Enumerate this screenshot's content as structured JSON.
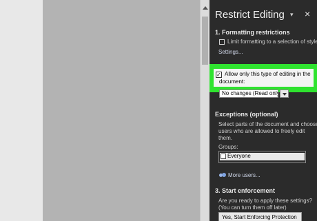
{
  "pane": {
    "title": "Restrict Editing",
    "chevron": "▾",
    "close": "×"
  },
  "formatting": {
    "heading": "1. Formatting restrictions",
    "limit_label": "Limit formatting to a selection of styles",
    "settings_link": "Settings..."
  },
  "editing": {
    "allow_label_line1": "Allow only this type of editing in the",
    "allow_label_line2": "document:",
    "allow_checked": true,
    "check_mark": "✓",
    "mode_value": "No changes (Read only)"
  },
  "exceptions": {
    "heading": "Exceptions (optional)",
    "desc_line1": "Select parts of the document and choose",
    "desc_line2": "users who are allowed to freely edit",
    "desc_line3": "them.",
    "groups_label": "Groups:",
    "groups": [
      {
        "label": "Everyone",
        "checked": false
      }
    ],
    "more_users_link": "More users..."
  },
  "enforcement": {
    "heading": "3. Start enforcement",
    "question_line1": "Are you ready to apply these settings?",
    "question_line2": "(You can turn them off later)",
    "start_button": "Yes, Start Enforcing Protection"
  },
  "colors": {
    "highlight": "#2fe32f",
    "pane_bg": "#2b2b2b",
    "document_bg": "#b3b3b3"
  }
}
